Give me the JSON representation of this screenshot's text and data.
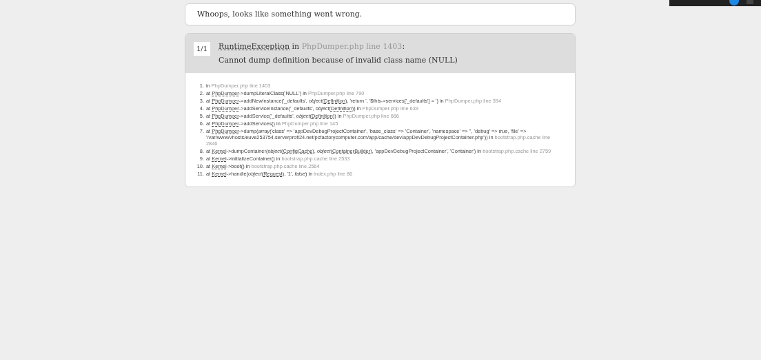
{
  "message": "Whoops, looks like something went wrong.",
  "exception": {
    "counter": "1/1",
    "class": "RuntimeException",
    "in": " in ",
    "location": "PhpDumper.php line 1403",
    "colon": ":",
    "text": "Cannot dump definition because of invalid class name (NULL)"
  },
  "trace": [
    {
      "number": "1.",
      "parts": [
        {
          "kind": "plain",
          "text": "in "
        },
        {
          "kind": "loc",
          "text": "PhpDumper.php line 1403"
        }
      ]
    },
    {
      "number": "2.",
      "parts": [
        {
          "kind": "plain",
          "text": "at "
        },
        {
          "kind": "abbr",
          "text": "PhpDumper"
        },
        {
          "kind": "plain",
          "text": "->dumpLiteralClass('NULL') in "
        },
        {
          "kind": "loc",
          "text": "PhpDumper.php line 790"
        }
      ]
    },
    {
      "number": "3.",
      "parts": [
        {
          "kind": "plain",
          "text": "at "
        },
        {
          "kind": "abbr",
          "text": "PhpDumper"
        },
        {
          "kind": "plain",
          "text": "->addNewInstance('_defaults', "
        },
        {
          "kind": "em",
          "text": "object"
        },
        {
          "kind": "plain",
          "text": "("
        },
        {
          "kind": "abbr",
          "text": "Definition"
        },
        {
          "kind": "plain",
          "text": "), 'return ', '$this->services['_defaults'] = ') in "
        },
        {
          "kind": "loc",
          "text": "PhpDumper.php line 394"
        }
      ]
    },
    {
      "number": "4.",
      "parts": [
        {
          "kind": "plain",
          "text": "at "
        },
        {
          "kind": "abbr",
          "text": "PhpDumper"
        },
        {
          "kind": "plain",
          "text": "->addServiceInstance('_defaults', "
        },
        {
          "kind": "em",
          "text": "object"
        },
        {
          "kind": "plain",
          "text": "("
        },
        {
          "kind": "abbr",
          "text": "Definition"
        },
        {
          "kind": "plain",
          "text": ")) in "
        },
        {
          "kind": "loc",
          "text": "PhpDumper.php line 639"
        }
      ]
    },
    {
      "number": "5.",
      "parts": [
        {
          "kind": "plain",
          "text": "at "
        },
        {
          "kind": "abbr",
          "text": "PhpDumper"
        },
        {
          "kind": "plain",
          "text": "->addService('_defaults', "
        },
        {
          "kind": "em",
          "text": "object"
        },
        {
          "kind": "plain",
          "text": "("
        },
        {
          "kind": "abbr",
          "text": "Definition"
        },
        {
          "kind": "plain",
          "text": ")) in "
        },
        {
          "kind": "loc",
          "text": "PhpDumper.php line 666"
        }
      ]
    },
    {
      "number": "6.",
      "parts": [
        {
          "kind": "plain",
          "text": "at "
        },
        {
          "kind": "abbr",
          "text": "PhpDumper"
        },
        {
          "kind": "plain",
          "text": "->addServices() in "
        },
        {
          "kind": "loc",
          "text": "PhpDumper.php line 145"
        }
      ]
    },
    {
      "number": "7.",
      "parts": [
        {
          "kind": "plain",
          "text": "at "
        },
        {
          "kind": "abbr",
          "text": "PhpDumper"
        },
        {
          "kind": "plain",
          "text": "->dump("
        },
        {
          "kind": "em",
          "text": "array"
        },
        {
          "kind": "plain",
          "text": "('class' => 'appDevDebugProjectContainer', 'base_class' => 'Container', 'namespace' => '', 'debug' => "
        },
        {
          "kind": "em",
          "text": "true"
        },
        {
          "kind": "plain",
          "text": ", 'file' => '/var/www/vhosts/euve253754.serverprofi24.net/pcfactorycomputer.com/app/cache/dev/appDevDebugProjectContainer.php')) in "
        },
        {
          "kind": "loc",
          "text": "bootstrap.php.cache line 2846"
        }
      ]
    },
    {
      "number": "8.",
      "parts": [
        {
          "kind": "plain",
          "text": "at "
        },
        {
          "kind": "abbr",
          "text": "Kernel"
        },
        {
          "kind": "plain",
          "text": "->dumpContainer("
        },
        {
          "kind": "em",
          "text": "object"
        },
        {
          "kind": "plain",
          "text": "("
        },
        {
          "kind": "abbr",
          "text": "ConfigCache"
        },
        {
          "kind": "plain",
          "text": "), "
        },
        {
          "kind": "em",
          "text": "object"
        },
        {
          "kind": "plain",
          "text": "("
        },
        {
          "kind": "abbr",
          "text": "ContainerBuilder"
        },
        {
          "kind": "plain",
          "text": "), 'appDevDebugProjectContainer', 'Container') in "
        },
        {
          "kind": "loc",
          "text": "bootstrap.php.cache line 2759"
        }
      ]
    },
    {
      "number": "9.",
      "parts": [
        {
          "kind": "plain",
          "text": "at "
        },
        {
          "kind": "abbr",
          "text": "Kernel"
        },
        {
          "kind": "plain",
          "text": "->initializeContainer() in "
        },
        {
          "kind": "loc",
          "text": "bootstrap.php.cache line 2533"
        }
      ]
    },
    {
      "number": "10.",
      "parts": [
        {
          "kind": "plain",
          "text": "at "
        },
        {
          "kind": "abbr",
          "text": "Kernel"
        },
        {
          "kind": "plain",
          "text": "->boot() in "
        },
        {
          "kind": "loc",
          "text": "bootstrap.php.cache line 2564"
        }
      ]
    },
    {
      "number": "11.",
      "parts": [
        {
          "kind": "plain",
          "text": "at "
        },
        {
          "kind": "abbr",
          "text": "Kernel"
        },
        {
          "kind": "plain",
          "text": "->handle("
        },
        {
          "kind": "em",
          "text": "object"
        },
        {
          "kind": "plain",
          "text": "("
        },
        {
          "kind": "abbr",
          "text": "Request"
        },
        {
          "kind": "plain",
          "text": "), '1', "
        },
        {
          "kind": "em",
          "text": "false"
        },
        {
          "kind": "plain",
          "text": ") in "
        },
        {
          "kind": "loc",
          "text": "index.php line 86"
        }
      ]
    }
  ]
}
